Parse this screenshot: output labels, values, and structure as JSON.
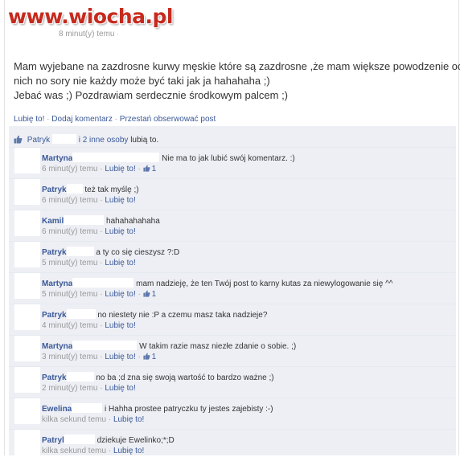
{
  "watermark": "www.wiocha.pl",
  "post": {
    "time": "8 minut(y) temu",
    "sep": "·",
    "lines": [
      "Mam wyjebane na zazdrosne kurwy męskie które są zazdrosne ,że mam większe powodzenie od",
      "nich no sory nie każdy może być taki jak ja hahahaha ;)",
      "Jebać was ;) Pozdrawiam serdecznie środkowym palcem ;)"
    ]
  },
  "actions": {
    "like": "Lubię to!",
    "comment": "Dodaj komentarz",
    "unfollow": "Przestań obserwować post",
    "sep": "·"
  },
  "likes": {
    "name": "Patryk",
    "others": "i 2 inne osoby",
    "suffix": "lubią to."
  },
  "comments": [
    {
      "name": "Martyna",
      "text": "Nie ma to jak lubić swój komentarz. :)",
      "time": "6 minut(y) temu",
      "like": "Lubię to!",
      "likes": "1"
    },
    {
      "name": "Patryk",
      "text": "też tak myślę ;)",
      "time": "6 minut(y) temu",
      "like": "Lubię to!",
      "likes": ""
    },
    {
      "name": "Kamil",
      "text": "hahahahahaha",
      "time": "6 minut(y) temu",
      "like": "Lubię to!",
      "likes": ""
    },
    {
      "name": "Patryk",
      "text": "a ty co się cieszysz ?:D",
      "time": "5 minut(y) temu",
      "like": "Lubię to!",
      "likes": ""
    },
    {
      "name": "Martyna",
      "text": "mam nadzieję, że ten Twój post to karny kutas za niewylogowanie się ^^",
      "time": "5 minut(y) temu",
      "like": "Lubię to!",
      "likes": "1"
    },
    {
      "name": "Patryk",
      "text": "no niestety nie :P a czemu masz taka nadzieje?",
      "time": "4 minut(y) temu",
      "like": "Lubię to!",
      "likes": ""
    },
    {
      "name": "Martyna",
      "text": "W takim razie masz niezłe zdanie o sobie. ;)",
      "time": "3 minut(y) temu",
      "like": "Lubię to!",
      "likes": "1"
    },
    {
      "name": "Patryk",
      "text": "no ba ;d zna się swoją wartość to bardzo ważne ;)",
      "time": "2 minut(y) temu",
      "like": "Lubię to!",
      "likes": ""
    },
    {
      "name": "Ewelina",
      "text": "i Hahha prostee patryczku ty jestes zajebisty :-)",
      "time": "kilka sekund temu",
      "like": "Lubię to!",
      "likes": ""
    },
    {
      "name": "Patryl",
      "text": "dziekuje Ewelinko;*;D",
      "time": "kilka sekund temu",
      "like": "Lubię to!",
      "likes": ""
    }
  ],
  "colors": {
    "link": "#3b5998",
    "panel": "#edeff4",
    "watermark": "#c62a1e"
  },
  "icons": {
    "like": "thumbs-up-icon"
  }
}
